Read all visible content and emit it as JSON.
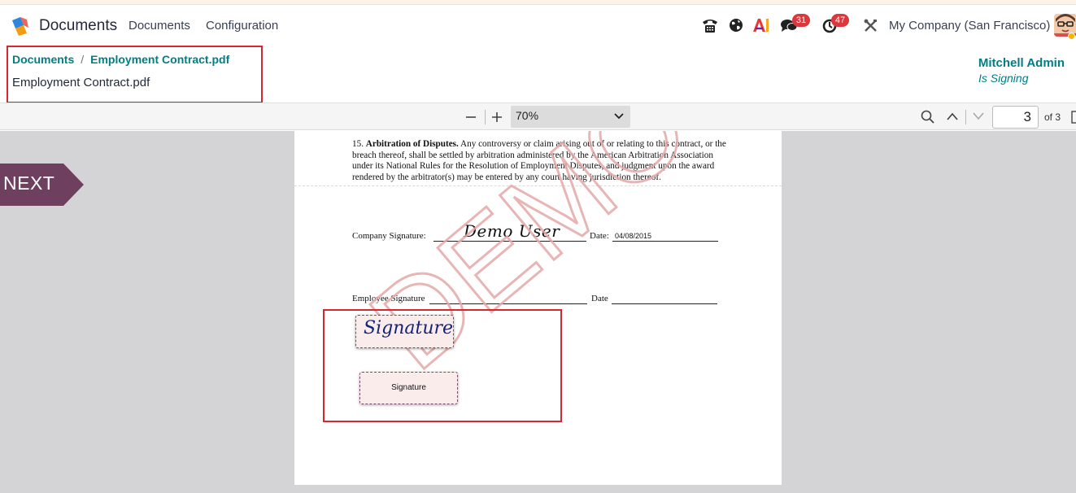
{
  "navbar": {
    "app_name": "Documents",
    "menu": [
      "Documents",
      "Configuration"
    ],
    "badges": {
      "messages": "31",
      "activities": "47"
    },
    "company": "My Company (San Francisco)",
    "icons": [
      "phone-icon",
      "globe-icon",
      "ai-icon",
      "chat-icon",
      "clock-icon",
      "tools-icon"
    ]
  },
  "breadcrumb": {
    "parent": "Documents",
    "separator": "/",
    "current": "Employment Contract.pdf"
  },
  "record_title": "Employment Contract.pdf",
  "signer": {
    "name": "Mitchell Admin",
    "status": "Is Signing"
  },
  "pdf_toolbar": {
    "zoom": "70%",
    "page_number": "3",
    "page_total": "of 3"
  },
  "document": {
    "clause_number": "15.",
    "clause_title": "Arbitration of Disputes.",
    "clause_body": "Any controversy or claim arising out of or relating to this contract, or the breach thereof, shall be settled by arbitration administered by the American Arbitration Association under its National Rules for the Resolution of Employment Disputes, and judgment upon the award rendered by the arbitrator(s) may be entered by any court having jurisdiction thereof.",
    "company_signature_label": "Company Signature:",
    "company_signature_value": "Demo User",
    "date_label_1": "Date:",
    "date_value_1": "04/08/2015",
    "employee_signature_label": "Employee Signature",
    "date_label_2": "Date",
    "watermark": "DEMO"
  },
  "sign_fields": {
    "filled_signature": "Signature",
    "empty_signature": "Signature"
  },
  "next_button": "NEXT",
  "colors": {
    "accent": "#017e84",
    "highlight": "#d7262e",
    "next_tag": "#6e3f5e",
    "watermark": "#e5a9a9"
  }
}
